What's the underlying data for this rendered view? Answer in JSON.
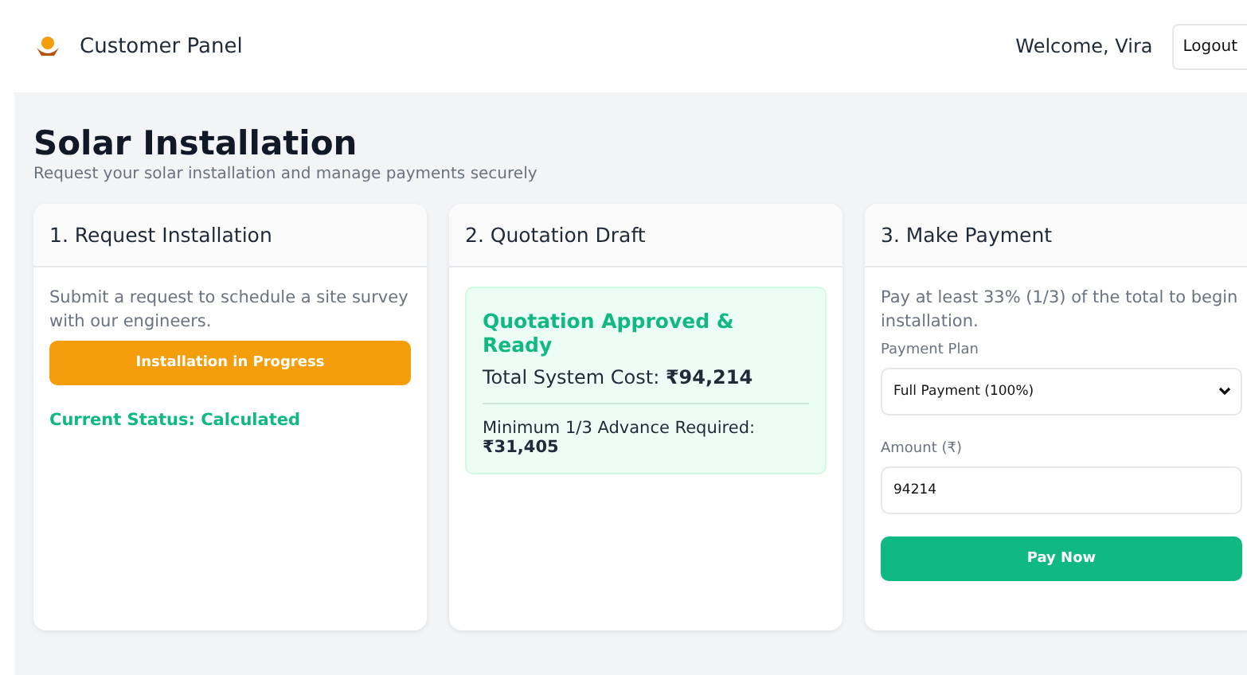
{
  "header": {
    "brand": "Customer Panel",
    "welcome": "Welcome, Vira",
    "logout": "Logout"
  },
  "page": {
    "title": "Solar Installation",
    "subtitle": "Request your solar installation and manage payments securely"
  },
  "cards": [
    {
      "kind": "request",
      "title": "1. Request Installation",
      "text": "Submit a request to schedule a site survey with our engineers.",
      "button": "Installation in Progress",
      "status": "Current Status: Calculated"
    },
    {
      "kind": "quotation",
      "title": "2. Quotation Draft",
      "heading": "Quotation Approved & Ready",
      "total": "Total System Cost: **₹94,214**",
      "advance": "Minimum 1/3 Advance Required: **₹31,405**"
    },
    {
      "kind": "payment",
      "title": "3. Make Payment",
      "text": "Pay at least 33% (1/3) of the total to begin installation.",
      "plan_label": "Payment Plan",
      "plan_value": "Full Payment (100%)",
      "amount_label": "Amount (₹)",
      "amount_value": "94214",
      "button": "Pay Now"
    }
  ]
}
